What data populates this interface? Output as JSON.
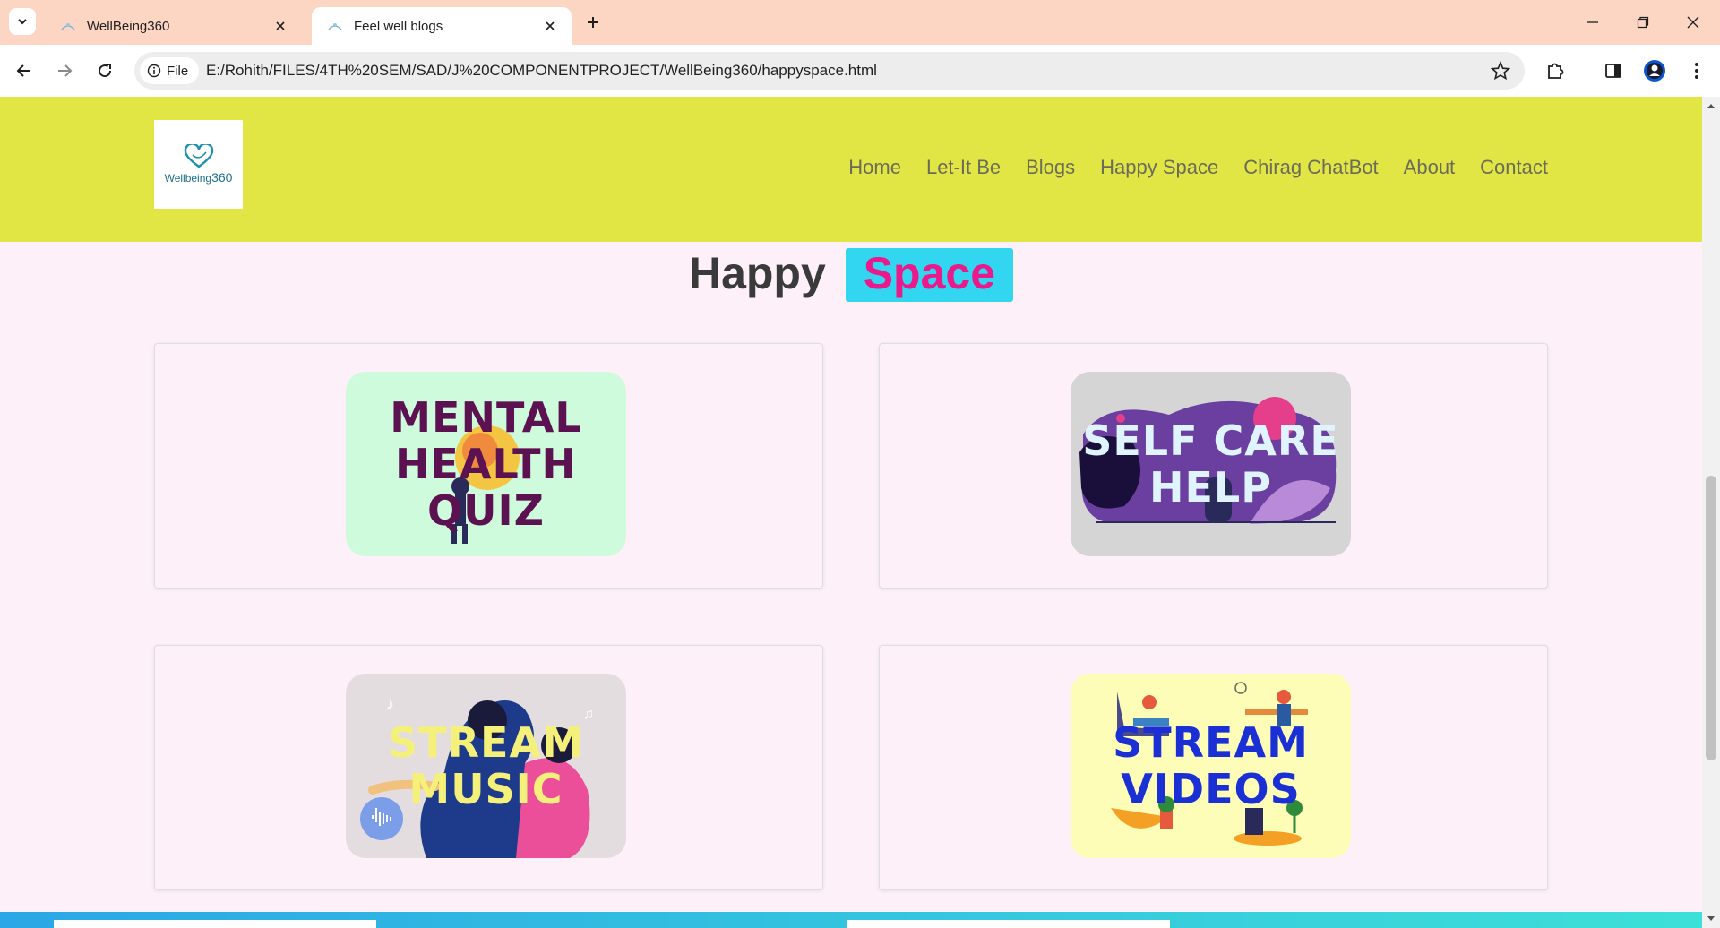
{
  "browser": {
    "tabs": [
      {
        "title": "WellBeing360",
        "active": false
      },
      {
        "title": "Feel well blogs",
        "active": true
      }
    ],
    "address_chip": "File",
    "url": "E:/Rohith/FILES/4TH%20SEM/SAD/J%20COMPONENTPROJECT/WellBeing360/happyspace.html"
  },
  "site": {
    "logo": {
      "word": "Wellbeing",
      "number": "360"
    },
    "nav": [
      "Home",
      "Let-It Be",
      "Blogs",
      "Happy Space",
      "Chirag ChatBot",
      "About",
      "Contact"
    ],
    "heading": {
      "word1": "Happy",
      "word2": "Space"
    },
    "cards": [
      {
        "line1": "MENTAL",
        "line2": "HEALTH",
        "line3": "QUIZ",
        "bg": "#cdfbdc",
        "text_color": "#5c1150"
      },
      {
        "line1": "SELF CARE",
        "line2": "HELP",
        "bg": "#d5d5d5",
        "text_color": "#dff4ff"
      },
      {
        "line1": "STREAM",
        "line2": "MUSIC",
        "bg": "#e4dde0",
        "text_color": "#f5f07a"
      },
      {
        "line1": "STREAM",
        "line2": "VIDEOS",
        "bg": "#fefdb8",
        "text_color": "#1a2fd4"
      }
    ]
  },
  "colors": {
    "tabbar": "#fcd5c3",
    "header": "#e2e645",
    "page_bg": "#fdf0f8",
    "accent_pink": "#ea1a8c",
    "accent_cyan": "#33d6f0"
  }
}
